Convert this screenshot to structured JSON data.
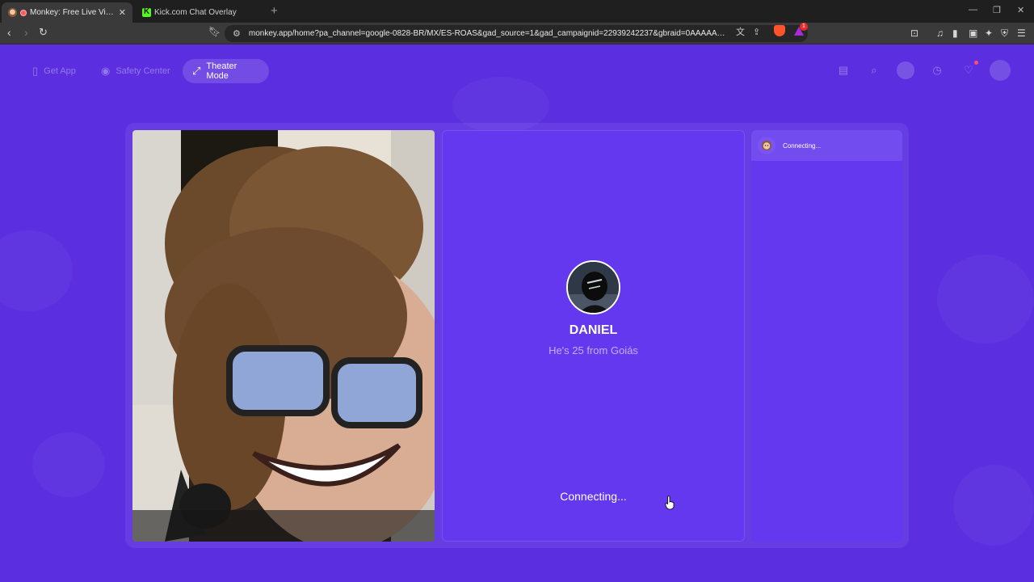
{
  "browser": {
    "tabs": [
      {
        "title": "Monkey: Free Live Video Chat"
      },
      {
        "title": "Kick.com Chat Overlay"
      }
    ],
    "new_tab": "+",
    "url": "monkey.app/home?pa_channel=google-0828-BR/MX/ES-ROAS&gad_source=1&gad_campaignid=22939242237&gbraid=0AAAAA_re0uDXhg...",
    "rewards_badge": "1"
  },
  "topnav": {
    "get_app": "Get App",
    "safety_center": "Safety Center",
    "theater_mode": "Theater Mode"
  },
  "peer": {
    "name": "DANIEL",
    "info": "He's 25 from Goiás",
    "status": "Connecting..."
  },
  "chat": {
    "status": "Connecting..."
  },
  "colors": {
    "page_bg": "#5b2fe0",
    "panel_bg": "#6338ee",
    "chrome_dark": "#1f1f1f"
  }
}
